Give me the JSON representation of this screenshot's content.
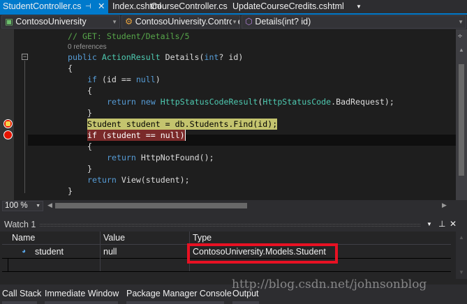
{
  "tabs": [
    {
      "label": "StudentController.cs",
      "active": true
    },
    {
      "label": "Index.cshtml"
    },
    {
      "label": "CourseController.cs"
    },
    {
      "label": "UpdateCourseCredits.cshtml"
    }
  ],
  "nav": {
    "project": "ContosoUniversity",
    "class": "ContosoUniversity.Controllers.Stuc",
    "member": "Details(int? id)"
  },
  "code": {
    "l1": "// GET: Student/Details/5",
    "refs": "0 references",
    "l3a": "public ",
    "l3b": "ActionResult",
    " l3c": "",
    "l3d": " Details(",
    "l3e": "int",
    "l3f": "? id)",
    "l4": "{",
    "l5a": "if",
    " l5b": "",
    "l5c": " (id == ",
    "l5d": "null",
    "l5e": ")",
    "l6": "{",
    "l7a": "return ",
    "l7b": "new ",
    "l7c": "HttpStatusCodeResult",
    "l7d": "(",
    "l7e": "HttpStatusCode",
    "l7f": ".BadRequest);",
    "l8": "}",
    "l9": "Student student = db.Students.Find(id);",
    "l10": "if (student == null)",
    "l11": "{",
    "l12a": "return ",
    "l12b": "HttpNotFound",
    "l12c": "();",
    "l13": "}",
    "l14a": "return ",
    "l14b": "View(student);",
    "l15": "}"
  },
  "zoom": "100 %",
  "watch": {
    "title": "Watch 1",
    "columns": [
      "Name",
      "Value",
      "Type"
    ],
    "rows": [
      {
        "name": "student",
        "value": "null",
        "type": "ContosoUniversity.Models.Student"
      }
    ]
  },
  "bottom_tabs": [
    "Call Stack",
    "Immediate Window",
    "Package Manager Console",
    "Output"
  ],
  "watermark": "http://blog.csdn.net/johnsonblog",
  "colors": {
    "accent": "#007acc",
    "highlight_box": "#e81123"
  }
}
